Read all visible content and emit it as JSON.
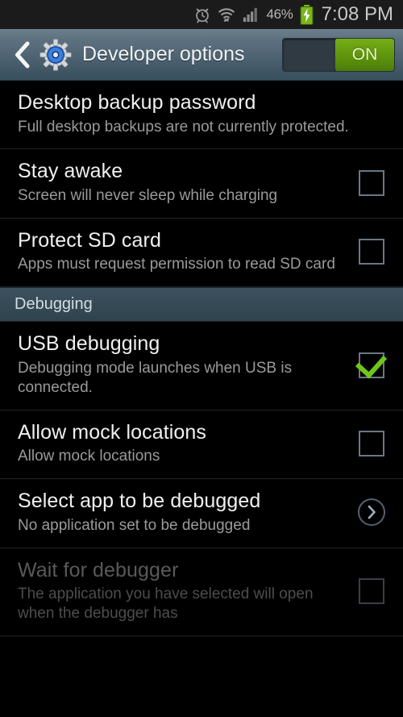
{
  "statusbar": {
    "icons": [
      "alarm-clock-icon",
      "wifi-icon",
      "cellular-signal-icon"
    ],
    "battery_percent": "46%",
    "battery_state": "charging",
    "clock": "7:08 PM"
  },
  "actionbar": {
    "back_icon": "back-chevron-icon",
    "app_icon": "settings-gear-icon",
    "title": "Developer options",
    "toggle": {
      "label": "ON",
      "state": "on",
      "on_color": "#62990f"
    }
  },
  "list": [
    {
      "kind": "item",
      "name": "desktop-backup-password",
      "title": "Desktop backup password",
      "summary": "Full desktop backups are not currently protected.",
      "widget": "none",
      "enabled": true
    },
    {
      "kind": "item",
      "name": "stay-awake",
      "title": "Stay awake",
      "summary": "Screen will never sleep while charging",
      "widget": "checkbox",
      "checked": false,
      "enabled": true
    },
    {
      "kind": "item",
      "name": "protect-sd-card",
      "title": "Protect SD card",
      "summary": "Apps must request permission to read SD card",
      "widget": "checkbox",
      "checked": false,
      "enabled": true
    },
    {
      "kind": "header",
      "name": "section-debugging",
      "title": "Debugging"
    },
    {
      "kind": "item",
      "name": "usb-debugging",
      "title": "USB debugging",
      "summary": "Debugging mode launches when USB is connected.",
      "widget": "checkbox",
      "checked": true,
      "enabled": true
    },
    {
      "kind": "item",
      "name": "allow-mock-locations",
      "title": "Allow mock locations",
      "summary": "Allow mock locations",
      "widget": "checkbox",
      "checked": false,
      "enabled": true
    },
    {
      "kind": "item",
      "name": "select-app-to-be-debugged",
      "title": "Select app to be debugged",
      "summary": "No application set to be debugged",
      "widget": "arrow",
      "enabled": true
    },
    {
      "kind": "item",
      "name": "wait-for-debugger",
      "title": "Wait for debugger",
      "summary": "The application you have selected will open when the debugger has",
      "widget": "checkbox",
      "checked": false,
      "enabled": false
    }
  ]
}
